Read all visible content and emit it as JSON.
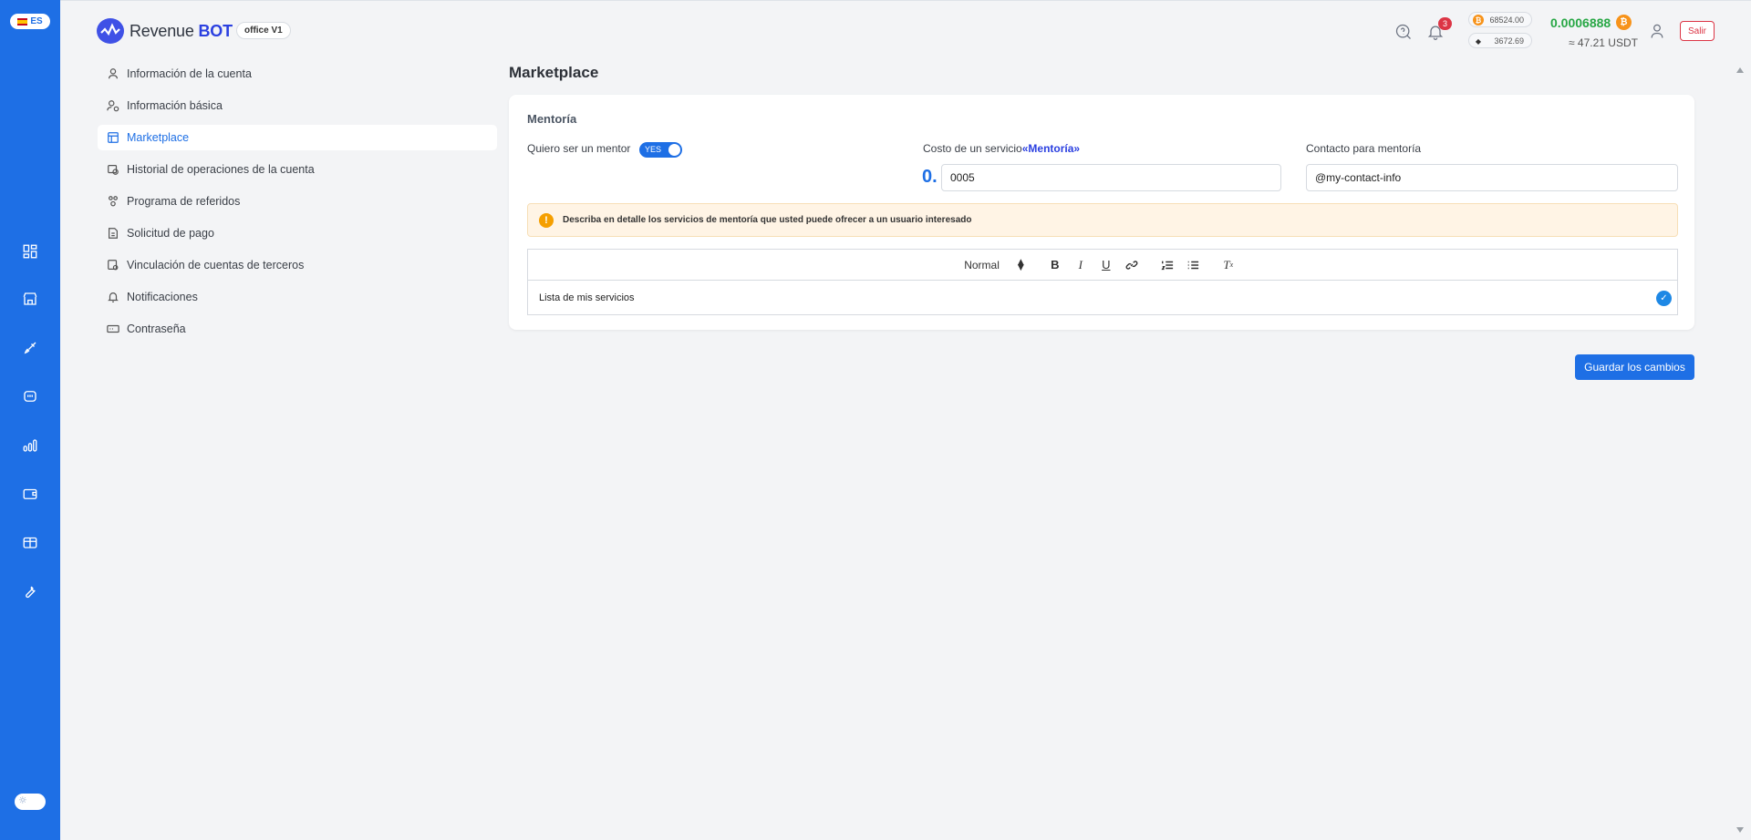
{
  "language": {
    "code": "ES"
  },
  "brand": {
    "name_part1": "Revenue",
    "name_part2": "BOT",
    "office": "office V1"
  },
  "header": {
    "notification_count": "3",
    "btc_price": "68524.00",
    "eth_price": "3672.69",
    "balance_btc": "0.0006888",
    "balance_usdt": "≈ 47.21 USDT",
    "logout_label": "Salir"
  },
  "rail_icons": [
    "dashboard-icon",
    "store-icon",
    "rocket-icon",
    "bot-icon",
    "stats-icon",
    "wallet-icon",
    "gift-icon",
    "wrench-icon"
  ],
  "menu": {
    "items": [
      {
        "label": "Información de la cuenta",
        "icon": "user-icon"
      },
      {
        "label": "Información básica",
        "icon": "user-settings-icon"
      },
      {
        "label": "Marketplace",
        "icon": "marketplace-icon",
        "active": true
      },
      {
        "label": "Historial de operaciones de la cuenta",
        "icon": "history-icon"
      },
      {
        "label": "Programa de referidos",
        "icon": "referral-icon"
      },
      {
        "label": "Solicitud de pago",
        "icon": "payment-request-icon"
      },
      {
        "label": "Vinculación de cuentas de terceros",
        "icon": "link-accounts-icon"
      },
      {
        "label": "Notificaciones",
        "icon": "bell-icon"
      },
      {
        "label": "Contraseña",
        "icon": "password-icon"
      }
    ]
  },
  "page": {
    "title": "Marketplace",
    "section_title": "Mentoría",
    "mentor_label": "Quiero ser un mentor",
    "mentor_toggle": "YES",
    "cost_label": "Costo de un servicio",
    "cost_label_highlight": "«Mentoría»",
    "cost_prefix": "0.",
    "cost_value": "0005",
    "contact_label": "Contacto para mentoría",
    "contact_value": "@my-contact-info",
    "alert_text": "Describa en detalle los servicios de mentoría que usted puede ofrecer a un usuario interesado",
    "editor_format": "Normal",
    "editor_content": "Lista de mis servicios",
    "save_label": "Guardar los cambios"
  },
  "colors": {
    "primary": "#1e6fe5",
    "balance": "#28a745",
    "danger": "#dc3545",
    "alert_bg": "#fff4e5"
  }
}
